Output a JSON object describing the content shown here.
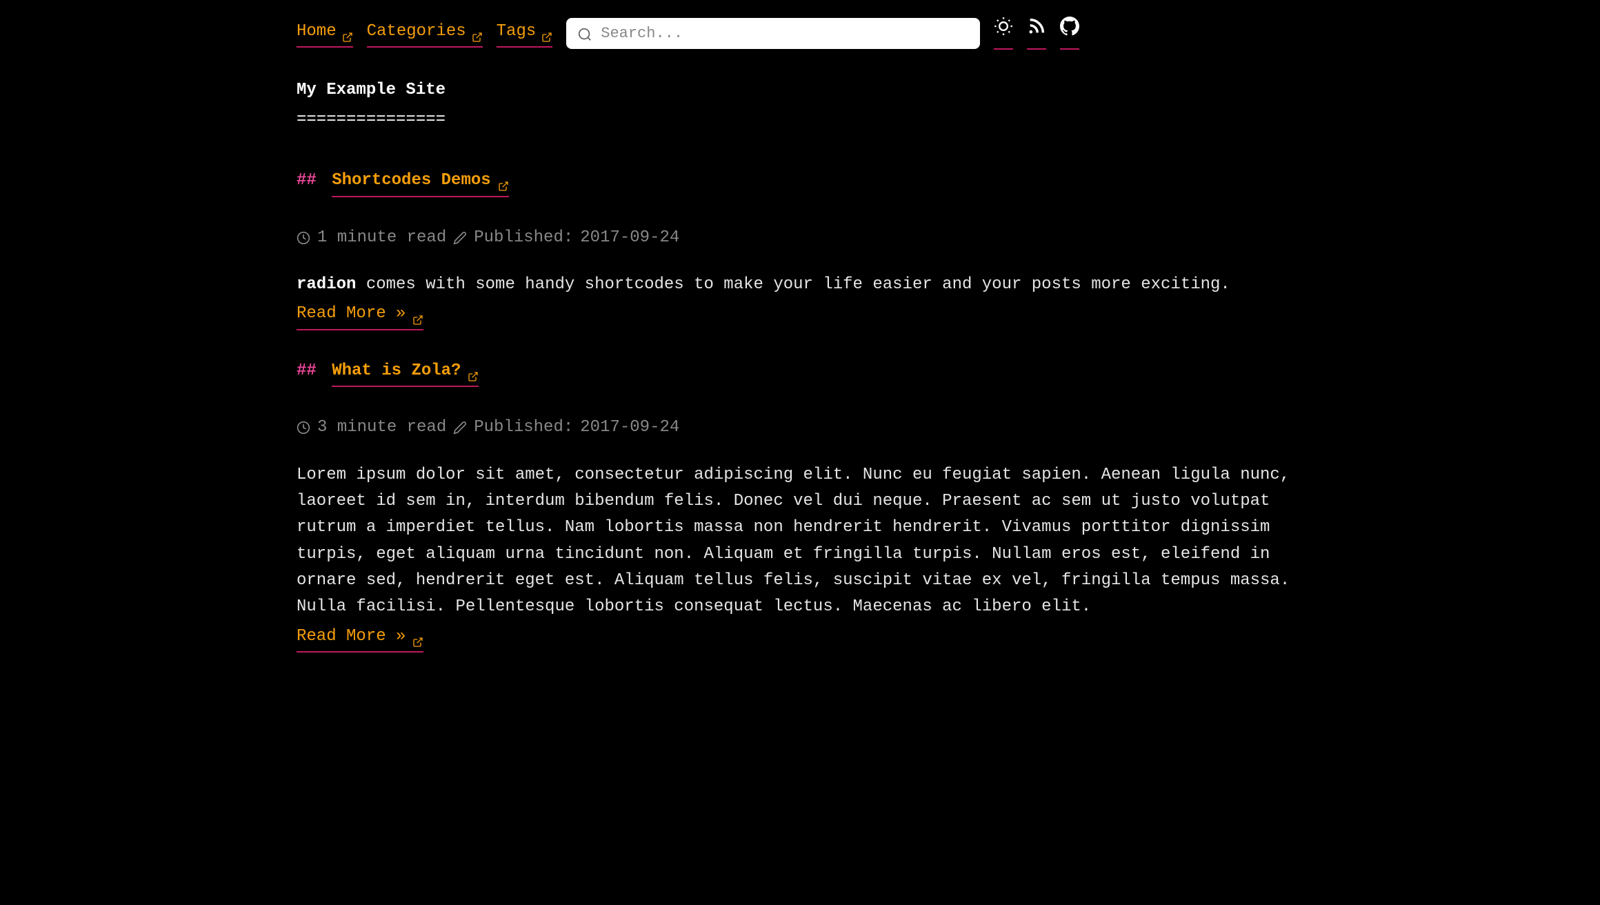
{
  "nav": {
    "items": [
      {
        "label": "Home"
      },
      {
        "label": "Categories"
      },
      {
        "label": "Tags"
      }
    ]
  },
  "search": {
    "placeholder": "Search..."
  },
  "site": {
    "title": "My Example Site",
    "title_underline": "==============="
  },
  "posts": [
    {
      "hash": "##",
      "title": "Shortcodes Demos",
      "read_time": "1 minute read",
      "published_label": "Published:",
      "published_date": "2017-09-24",
      "excerpt_bold": "radion",
      "excerpt_rest": " comes with some handy shortcodes to make your life easier and your posts more exciting.",
      "read_more": "Read More »"
    },
    {
      "hash": "##",
      "title": "What is Zola?",
      "read_time": "3 minute read",
      "published_label": "Published:",
      "published_date": "2017-09-24",
      "excerpt": "Lorem ipsum dolor sit amet, consectetur adipiscing elit. Nunc eu feugiat sapien. Aenean ligula nunc, laoreet id sem in, interdum bibendum felis. Donec vel dui neque. Praesent ac sem ut justo volutpat rutrum a imperdiet tellus. Nam lobortis massa non hendrerit hendrerit. Vivamus porttitor dignissim turpis, eget aliquam urna tincidunt non. Aliquam et fringilla turpis. Nullam eros est, eleifend in ornare sed, hendrerit eget est. Aliquam tellus felis, suscipit vitae ex vel, fringilla tempus massa. Nulla facilisi. Pellentesque lobortis consequat lectus. Maecenas ac libero elit.",
      "read_more": "Read More »"
    }
  ]
}
